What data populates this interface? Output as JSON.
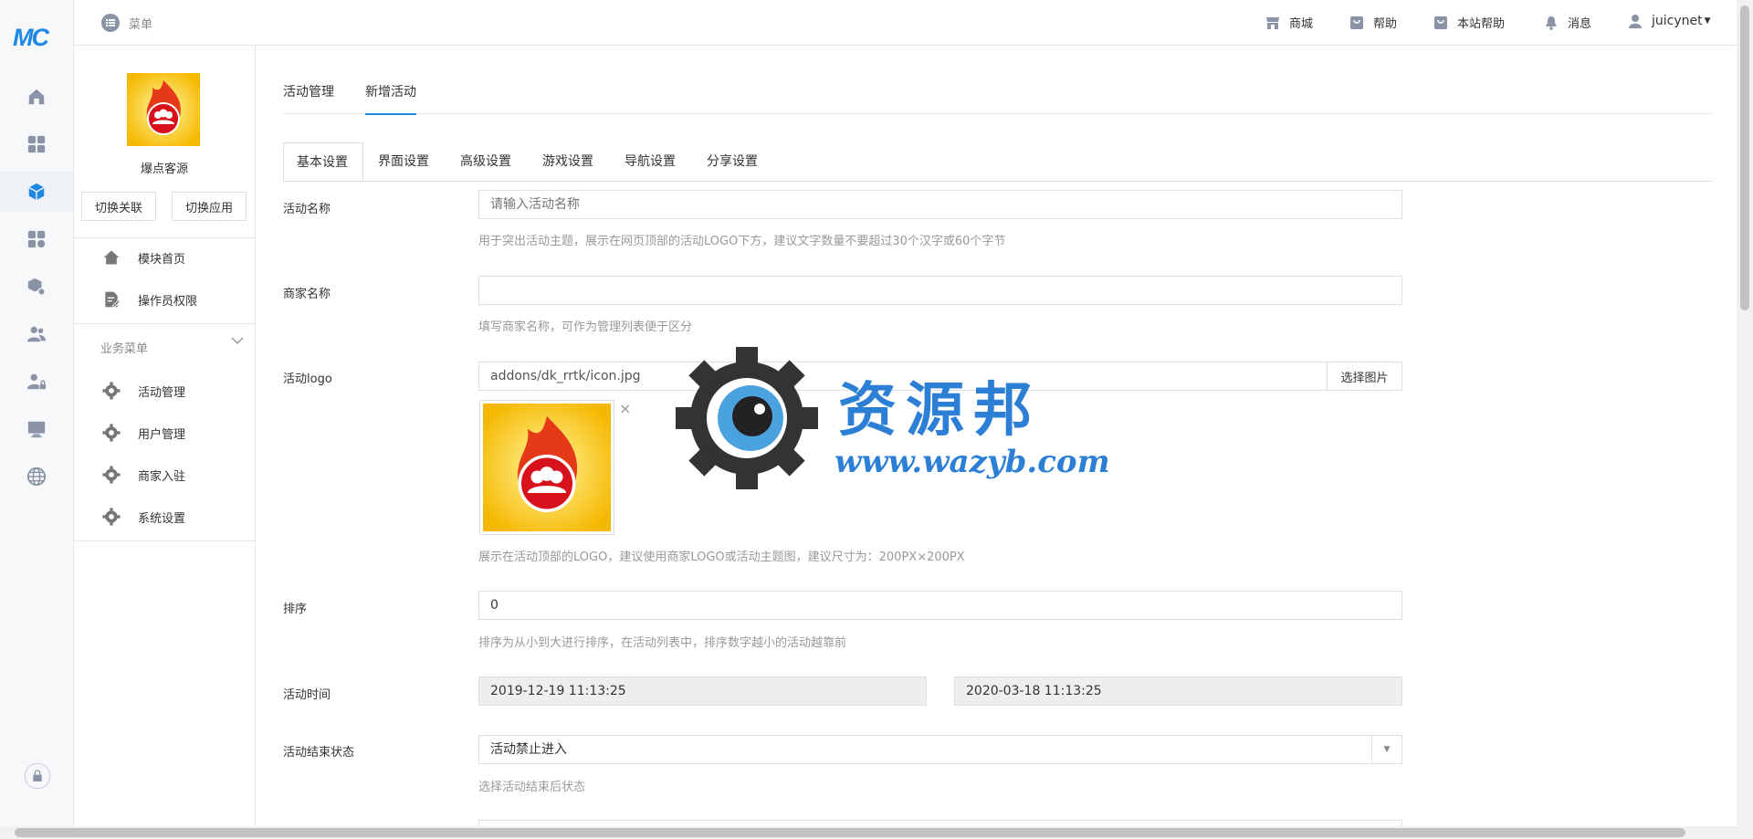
{
  "brand": {
    "logo_text": "MC"
  },
  "topbar": {
    "menu_label": "菜单",
    "links": [
      {
        "label": "商城",
        "icon": "shop-icon"
      },
      {
        "label": "帮助",
        "icon": "help-icon"
      },
      {
        "label": "本站帮助",
        "icon": "site-help-icon"
      },
      {
        "label": "消息",
        "icon": "bell-icon"
      }
    ],
    "user": "juicynet"
  },
  "rail": {
    "icons": [
      "home-icon",
      "dashboard-icon",
      "cube-icon",
      "apps-icon",
      "package-settings-icon",
      "users-icon",
      "user-lock-icon",
      "monitor-icon",
      "globe-icon",
      "lock-icon"
    ]
  },
  "panel": {
    "app_name": "爆点客源",
    "switch_link_label": "切换关联",
    "switch_app_label": "切换应用",
    "top_menu": [
      {
        "label": "模块首页",
        "icon": "home-icon"
      },
      {
        "label": "操作员权限",
        "icon": "doc-edit-icon"
      }
    ],
    "business_title": "业务菜单",
    "business_menu": [
      {
        "label": "活动管理",
        "icon": "gear-icon"
      },
      {
        "label": "用户管理",
        "icon": "gear-icon"
      },
      {
        "label": "商家入驻",
        "icon": "gear-icon"
      },
      {
        "label": "系统设置",
        "icon": "gear-icon"
      }
    ]
  },
  "main": {
    "top_tabs": [
      "活动管理",
      "新增活动"
    ],
    "sub_tabs": [
      "基本设置",
      "界面设置",
      "高级设置",
      "游戏设置",
      "导航设置",
      "分享设置"
    ],
    "form": {
      "name": {
        "label": "活动名称",
        "placeholder": "请输入活动名称",
        "help": "用于突出活动主题，展示在网页顶部的活动LOGO下方，建议文字数量不要超过30个汉字或60个字节"
      },
      "merchant": {
        "label": "商家名称",
        "value": "",
        "help": "填写商家名称，可作为管理列表便于区分"
      },
      "logo": {
        "label": "活动logo",
        "value": "addons/dk_rrtk/icon.jpg",
        "button": "选择图片",
        "remove": "×",
        "help": "展示在活动顶部的LOGO，建议使用商家LOGO或活动主题图，建议尺寸为：200PX×200PX"
      },
      "sort": {
        "label": "排序",
        "value": "0",
        "help": "排序为从小到大进行排序，在活动列表中，排序数字越小的活动越靠前"
      },
      "time": {
        "label": "活动时间",
        "start": "2019-12-19 11:13:25",
        "end": "2020-03-18 11:13:25"
      },
      "end_state": {
        "label": "活动结束状态",
        "value": "活动禁止进入",
        "help": "选择活动结束后状态"
      }
    }
  },
  "watermark": {
    "title": "资源邦",
    "url": "www.wazyb.com"
  }
}
